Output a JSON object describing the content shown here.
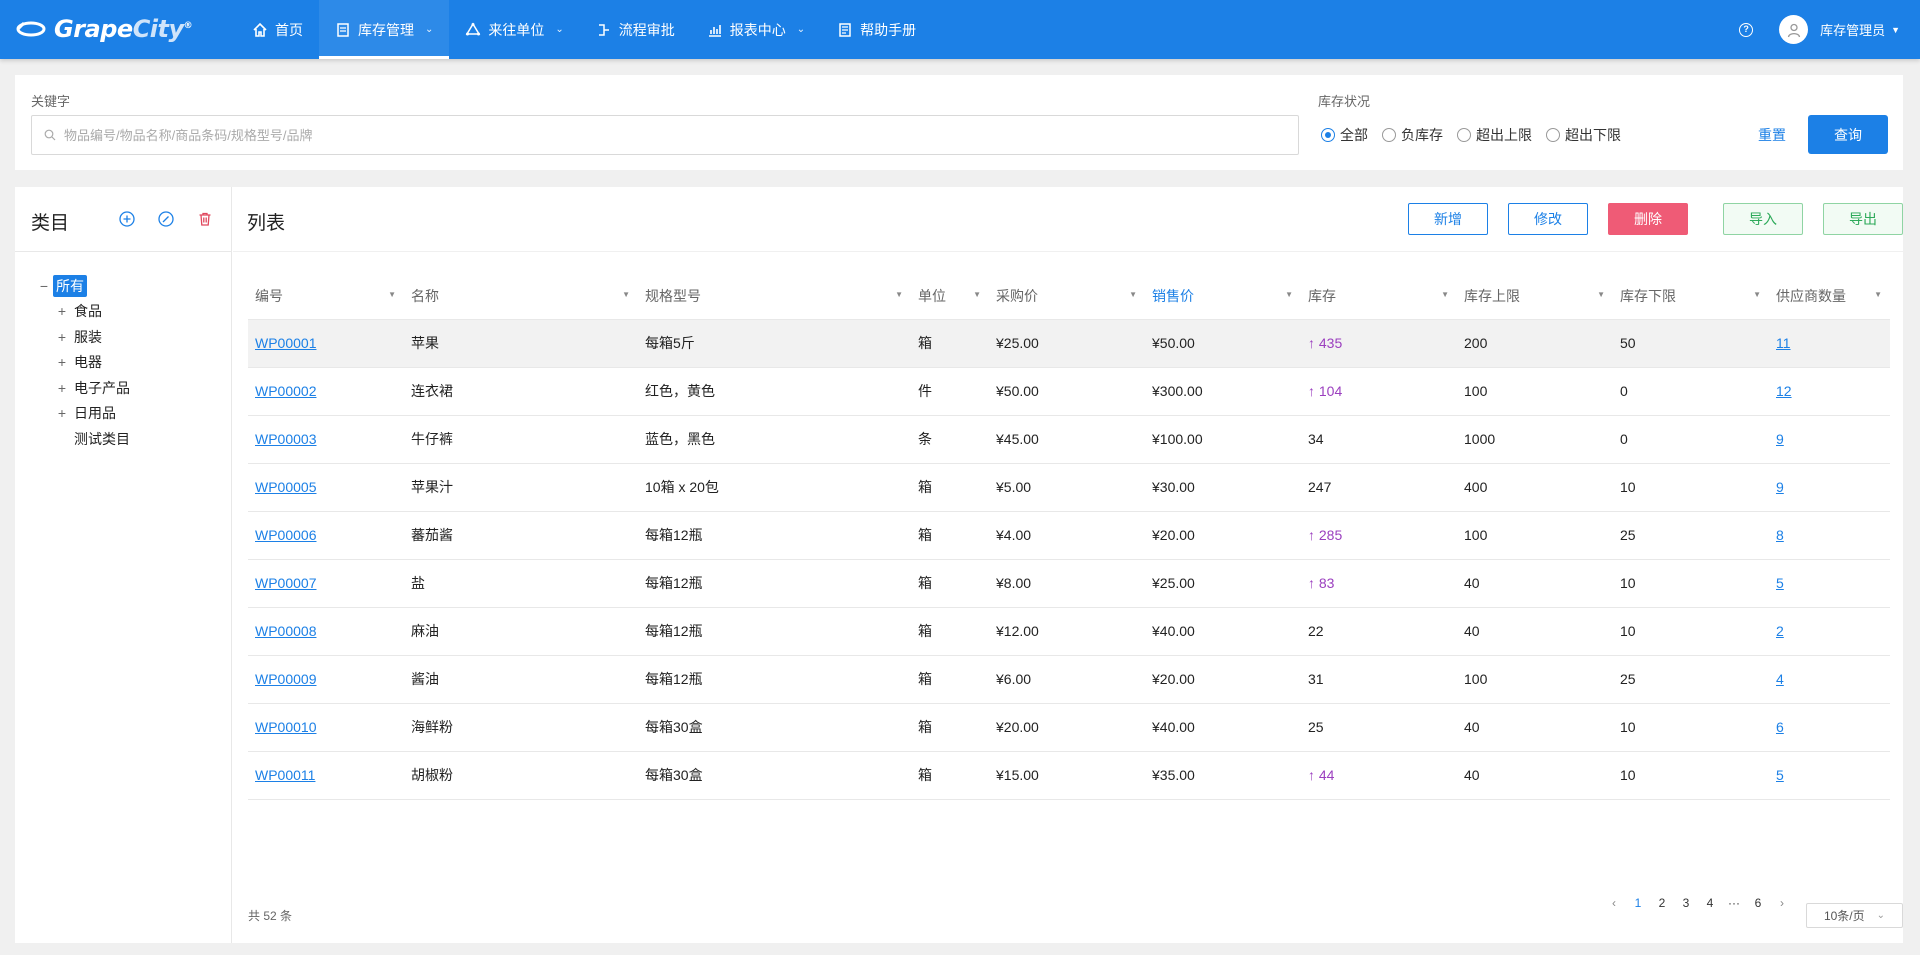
{
  "brand": {
    "name_a": "Grape",
    "name_b": "City",
    "reg": "®"
  },
  "nav": [
    {
      "label": "首页",
      "icon": "home-icon",
      "dropdown": false
    },
    {
      "label": "库存管理",
      "icon": "inventory-icon",
      "dropdown": true,
      "active": true
    },
    {
      "label": "来往单位",
      "icon": "partners-icon",
      "dropdown": true
    },
    {
      "label": "流程审批",
      "icon": "workflow-icon",
      "dropdown": false
    },
    {
      "label": "报表中心",
      "icon": "report-icon",
      "dropdown": true
    },
    {
      "label": "帮助手册",
      "icon": "manual-icon",
      "dropdown": false
    }
  ],
  "user": {
    "name": "库存管理员",
    "help": "?"
  },
  "search": {
    "keyword_label": "关键字",
    "placeholder": "物品编号/物品名称/商品条码/规格型号/品牌",
    "value": "",
    "status_label": "库存状况",
    "options": [
      "全部",
      "负库存",
      "超出上限",
      "超出下限"
    ],
    "selected": "全部",
    "reset_label": "重置",
    "query_label": "查询"
  },
  "category": {
    "title": "类目",
    "root": "所有",
    "items": [
      {
        "label": "食品",
        "expandable": true
      },
      {
        "label": "服装",
        "expandable": true
      },
      {
        "label": "电器",
        "expandable": true
      },
      {
        "label": "电子产品",
        "expandable": true
      },
      {
        "label": "日用品",
        "expandable": true
      },
      {
        "label": "测试类目",
        "expandable": false
      }
    ]
  },
  "list": {
    "title": "列表",
    "buttons": {
      "add": "新增",
      "edit": "修改",
      "delete": "删除",
      "import": "导入",
      "export": "导出"
    },
    "columns": [
      "编号",
      "名称",
      "规格型号",
      "单位",
      "采购价",
      "销售价",
      "库存",
      "库存上限",
      "库存下限",
      "供应商数量"
    ],
    "active_column": "销售价",
    "rows": [
      {
        "code": "WP00001",
        "name": "苹果",
        "spec": "每箱5斤",
        "unit": "箱",
        "buy": "¥25.00",
        "sell": "¥50.00",
        "stock": "435",
        "stock_up": true,
        "max": "200",
        "min": "50",
        "suppliers": "11"
      },
      {
        "code": "WP00002",
        "name": "连衣裙",
        "spec": "红色，黄色",
        "unit": "件",
        "buy": "¥50.00",
        "sell": "¥300.00",
        "stock": "104",
        "stock_up": true,
        "max": "100",
        "min": "0",
        "suppliers": "12"
      },
      {
        "code": "WP00003",
        "name": "牛仔裤",
        "spec": "蓝色，黑色",
        "unit": "条",
        "buy": "¥45.00",
        "sell": "¥100.00",
        "stock": "34",
        "stock_up": false,
        "max": "1000",
        "min": "0",
        "suppliers": "9"
      },
      {
        "code": "WP00005",
        "name": "苹果汁",
        "spec": "10箱 x 20包",
        "unit": "箱",
        "buy": "¥5.00",
        "sell": "¥30.00",
        "stock": "247",
        "stock_up": false,
        "max": "400",
        "min": "10",
        "suppliers": "9"
      },
      {
        "code": "WP00006",
        "name": "蕃茄酱",
        "spec": "每箱12瓶",
        "unit": "箱",
        "buy": "¥4.00",
        "sell": "¥20.00",
        "stock": "285",
        "stock_up": true,
        "max": "100",
        "min": "25",
        "suppliers": "8"
      },
      {
        "code": "WP00007",
        "name": "盐",
        "spec": "每箱12瓶",
        "unit": "箱",
        "buy": "¥8.00",
        "sell": "¥25.00",
        "stock": "83",
        "stock_up": true,
        "max": "40",
        "min": "10",
        "suppliers": "5"
      },
      {
        "code": "WP00008",
        "name": "麻油",
        "spec": "每箱12瓶",
        "unit": "箱",
        "buy": "¥12.00",
        "sell": "¥40.00",
        "stock": "22",
        "stock_up": false,
        "max": "40",
        "min": "10",
        "suppliers": "2"
      },
      {
        "code": "WP00009",
        "name": "酱油",
        "spec": "每箱12瓶",
        "unit": "箱",
        "buy": "¥6.00",
        "sell": "¥20.00",
        "stock": "31",
        "stock_up": false,
        "max": "100",
        "min": "25",
        "suppliers": "4"
      },
      {
        "code": "WP00010",
        "name": "海鲜粉",
        "spec": "每箱30盒",
        "unit": "箱",
        "buy": "¥20.00",
        "sell": "¥40.00",
        "stock": "25",
        "stock_up": false,
        "max": "40",
        "min": "10",
        "suppliers": "6"
      },
      {
        "code": "WP00011",
        "name": "胡椒粉",
        "spec": "每箱30盒",
        "unit": "箱",
        "buy": "¥15.00",
        "sell": "¥35.00",
        "stock": "44",
        "stock_up": true,
        "max": "40",
        "min": "10",
        "suppliers": "5"
      }
    ],
    "highlighted_row": 0,
    "total": "共 52 条",
    "pagination": {
      "pages": [
        "1",
        "2",
        "3",
        "4",
        "···",
        "6"
      ],
      "current": "1",
      "page_size": "10条/页"
    }
  },
  "colors": {
    "primary": "#1c80e6",
    "danger": "#ef5b76",
    "success": "#2eaa5a",
    "stock_up": "#9b3fbf"
  }
}
